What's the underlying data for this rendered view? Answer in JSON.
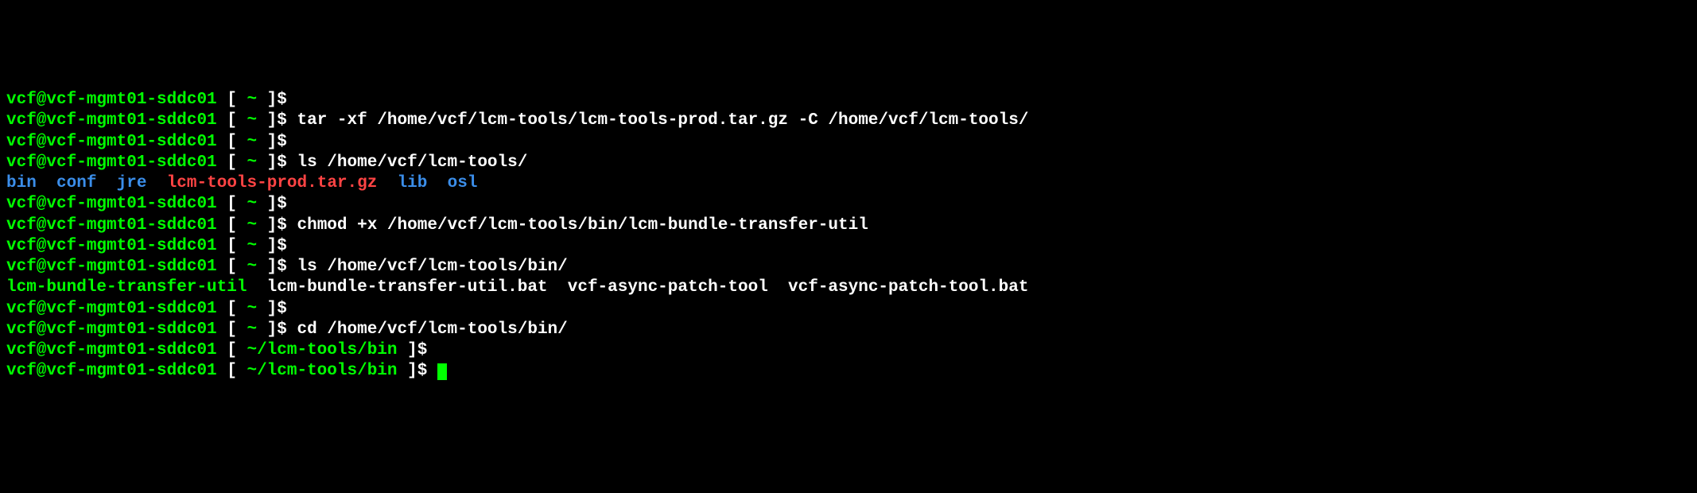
{
  "prompt_user_host": "vcf@vcf-mgmt01-sddc01",
  "prompt_bracket_open": " [ ",
  "prompt_bracket_close": " ]$",
  "cwd_home": "~",
  "cwd_bin": "~/lcm-tools/bin",
  "lines": {
    "cmd_tar": " tar -xf /home/vcf/lcm-tools/lcm-tools-prod.tar.gz -C /home/vcf/lcm-tools/",
    "cmd_ls1": " ls /home/vcf/lcm-tools/",
    "cmd_chmod": " chmod +x /home/vcf/lcm-tools/bin/lcm-bundle-transfer-util",
    "cmd_ls2": " ls /home/vcf/lcm-tools/bin/",
    "cmd_cd": " cd /home/vcf/lcm-tools/bin/"
  },
  "ls1_output": {
    "bin": "bin",
    "conf": "conf",
    "jre": "jre",
    "tarball": "lcm-tools-prod.tar.gz",
    "lib": "lib",
    "osl": "osl"
  },
  "ls2_output": {
    "util": "lcm-bundle-transfer-util",
    "util_bat": "lcm-bundle-transfer-util.bat",
    "patch": "vcf-async-patch-tool",
    "patch_bat": "vcf-async-patch-tool.bat"
  }
}
